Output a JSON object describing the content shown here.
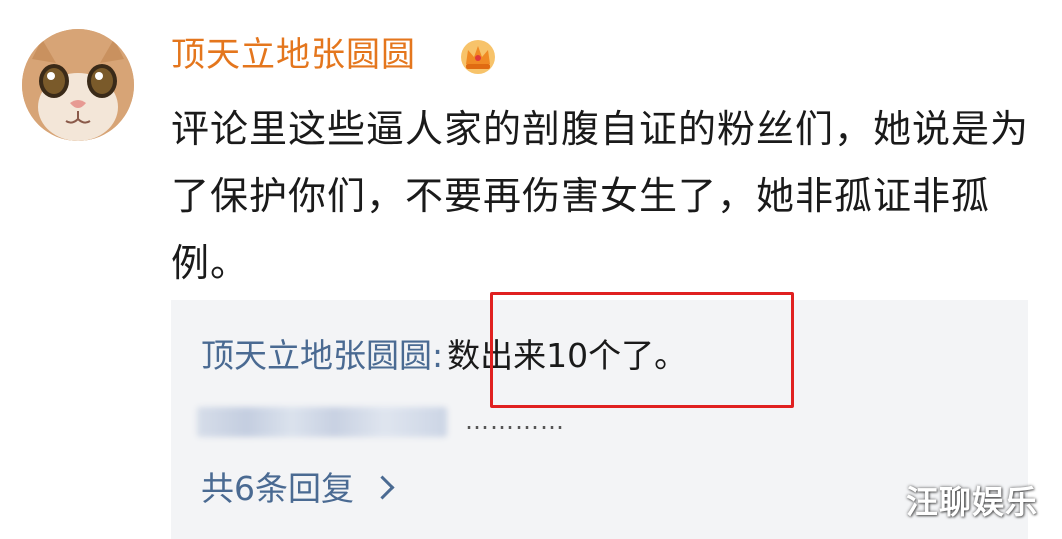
{
  "comment": {
    "username": "顶天立地张圆圆",
    "badge_icon": "crown-icon",
    "text": "评论里这些逼人家的剖腹自证的粉丝们，她说是为了保护你们，不要再伤害女生了，她非孤证非孤例。"
  },
  "reply_box": {
    "first_reply": {
      "author": "顶天立地张圆圆",
      "separator": ":",
      "content": "数出来10个了。"
    },
    "blurred_reply_suffix": "…………",
    "reply_count_label": "共6条回复"
  },
  "watermark": "汪聊娱乐",
  "colors": {
    "username": "#e4761d",
    "link": "#4a6a92",
    "highlight": "#e02020",
    "reply_bg": "#f3f4f6"
  }
}
